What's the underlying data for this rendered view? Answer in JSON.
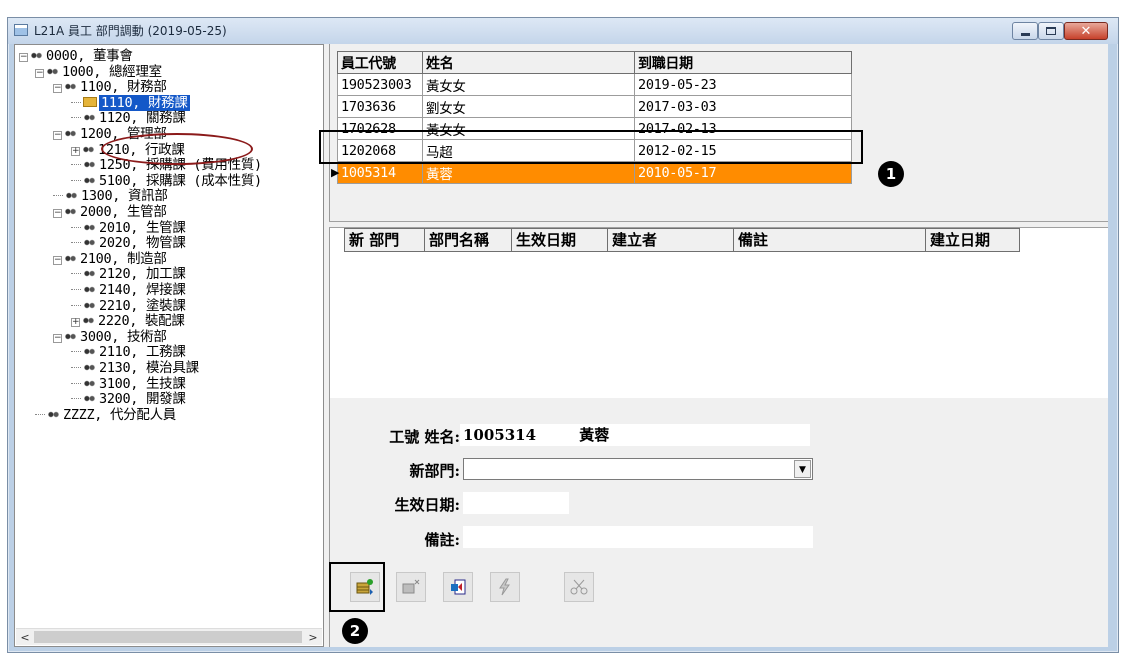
{
  "window": {
    "title": "L21A 員工 部門調動 (2019-05-25)"
  },
  "tree": {
    "items": [
      {
        "label": "0000, 董事會",
        "indent": 0,
        "expander": "−",
        "selected": false
      },
      {
        "label": "1000, 總經理室",
        "indent": 1,
        "expander": "−",
        "selected": false
      },
      {
        "label": "1100, 財務部",
        "indent": 2,
        "expander": "−",
        "selected": false
      },
      {
        "label": "1110, 財務課",
        "indent": 3,
        "expander": "",
        "selected": true
      },
      {
        "label": "1120, 關務課",
        "indent": 3,
        "expander": "",
        "selected": false
      },
      {
        "label": "1200, 管理部",
        "indent": 2,
        "expander": "−",
        "selected": false
      },
      {
        "label": "1210, 行政課",
        "indent": 3,
        "expander": "+",
        "selected": false
      },
      {
        "label": "1250, 採購課 (費用性質)",
        "indent": 3,
        "expander": "",
        "selected": false
      },
      {
        "label": "5100, 採購課 (成本性質)",
        "indent": 3,
        "expander": "",
        "selected": false
      },
      {
        "label": "1300, 資訊部",
        "indent": 2,
        "expander": "",
        "selected": false
      },
      {
        "label": "2000, 生管部",
        "indent": 2,
        "expander": "−",
        "selected": false
      },
      {
        "label": "2010, 生管課",
        "indent": 3,
        "expander": "",
        "selected": false
      },
      {
        "label": "2020, 物管課",
        "indent": 3,
        "expander": "",
        "selected": false
      },
      {
        "label": "2100, 制造部",
        "indent": 2,
        "expander": "−",
        "selected": false
      },
      {
        "label": "2120, 加工課",
        "indent": 3,
        "expander": "",
        "selected": false
      },
      {
        "label": "2140, 焊接課",
        "indent": 3,
        "expander": "",
        "selected": false
      },
      {
        "label": "2210, 塗裝課",
        "indent": 3,
        "expander": "",
        "selected": false
      },
      {
        "label": "2220, 裝配課",
        "indent": 3,
        "expander": "+",
        "selected": false
      },
      {
        "label": "3000, 技術部",
        "indent": 2,
        "expander": "−",
        "selected": false
      },
      {
        "label": "2110, 工務課",
        "indent": 3,
        "expander": "",
        "selected": false
      },
      {
        "label": "2130, 模治具課",
        "indent": 3,
        "expander": "",
        "selected": false
      },
      {
        "label": "3100, 生技課",
        "indent": 3,
        "expander": "",
        "selected": false
      },
      {
        "label": "3200, 開發課",
        "indent": 3,
        "expander": "",
        "selected": false
      },
      {
        "label": "ZZZZ, 代分配人員",
        "indent": 1,
        "expander": "",
        "selected": false
      }
    ]
  },
  "employees": {
    "headers": [
      "員工代號",
      "姓名",
      "到職日期"
    ],
    "rows": [
      [
        "190523003",
        "黃女女",
        "2019-05-23"
      ],
      [
        "1703636",
        "劉女女",
        "2017-03-03"
      ],
      [
        "1702628",
        "黃女女",
        "2017-02-13"
      ],
      [
        "1202068",
        "马超",
        "2012-02-15"
      ],
      [
        "1005314",
        "黃蓉",
        "2010-05-17"
      ]
    ],
    "active_row": 4,
    "active_color": "#ff8c00"
  },
  "transfers": {
    "headers": [
      "新 部門",
      "部門名稱",
      "生效日期",
      "建立者",
      "備註",
      "建立日期"
    ]
  },
  "form": {
    "id_name_label": "工號 姓名:",
    "emp_id": "1005314",
    "emp_name": "黃蓉",
    "new_dept_label": "新部門:",
    "new_dept_value": "",
    "effective_label": "生效日期:",
    "effective_value": "",
    "note_label": "備註:",
    "note_value": ""
  },
  "badges": {
    "one": "1",
    "two": "2"
  },
  "icons": {
    "minimize": "minimize-icon",
    "maximize": "maximize-icon",
    "close": "close-icon",
    "add_record": "add-record-icon",
    "delete_record": "delete-record-icon",
    "exit": "exit-icon",
    "execute": "lightning-icon",
    "cut": "scissors-icon"
  }
}
